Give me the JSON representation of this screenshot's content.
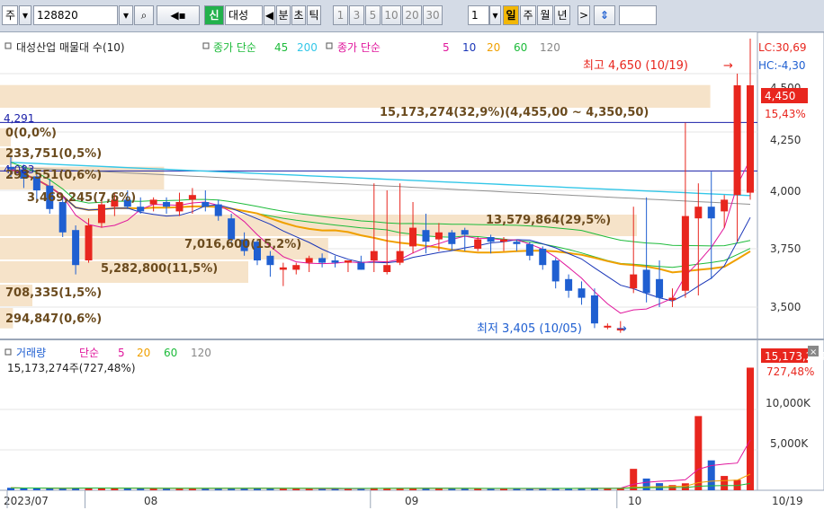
{
  "toolbar": {
    "market": "주",
    "code": "128820",
    "search_icon": "search-icon",
    "sound_icon": "speaker-icon",
    "new_badge": "신",
    "stock_name": "대성",
    "prev_arrow": "◀",
    "units": [
      "분",
      "초",
      "틱"
    ],
    "periods": [
      "1",
      "3",
      "5",
      "10",
      "20",
      "30"
    ],
    "count": "1",
    "day": "일",
    "week": "주",
    "month": "월",
    "year": "년",
    "next_arrow": ">",
    "updown_icon": "updown-arrow-icon"
  },
  "price_panel": {
    "legend": {
      "volume_profile": "대성산업 매물대 수(10)",
      "ma_label_1": "종가 단순",
      "ma_values_1": [
        "45",
        "200"
      ],
      "ma_label_2": "종가 단순",
      "ma_values_2": [
        "5",
        "10",
        "20",
        "60",
        "120"
      ]
    },
    "lc": "LC:30,69",
    "hc": "HC:-4,30",
    "high_note": "최고 4,650 (10/19)",
    "low_note": "최저 3,405 (10/05)",
    "current_price": "4,450",
    "current_pct": "15,43%",
    "line_4291": "4,291",
    "line_4083": "4,083",
    "profile_labels": [
      "15,173,274(32,9%)(4,455,00 ~ 4,350,50)",
      "0(0,0%)",
      "233,751(0,5%)",
      "293,551(0,6%)",
      "3,469,245(7,6%)",
      "13,579,864(29,5%)",
      "7,016,600(15,2%)",
      "5,282,800(11,5%)",
      "708,335(1,5%)",
      "294,847(0,6%)"
    ],
    "y_ticks": [
      "4,500",
      "4,250",
      "4,000",
      "3,750",
      "3,500"
    ]
  },
  "volume_panel": {
    "legend_title": "거래량",
    "legend_ma_label": "단순",
    "legend_ma_values": [
      "5",
      "20",
      "60",
      "120"
    ],
    "info": "15,173,274주(727,48%)",
    "current_volume": "15,173,274",
    "current_pct": "727,48%",
    "y_ticks": [
      "10,000K",
      "5,000K"
    ]
  },
  "x_axis": {
    "labels": [
      "2023/07",
      "08",
      "09",
      "10"
    ],
    "end_date": "10/19"
  },
  "colors": {
    "up": "#e8261e",
    "down": "#1f5fd1",
    "ma5": "#e0169c",
    "ma10": "#1a36b8",
    "ma20": "#f0a000",
    "ma60": "#1dbb3a",
    "ma120": "#909090",
    "ma45": "#1dbb3a",
    "ma200": "#33c7e8",
    "profile": "#f6e3c9",
    "profile_text": "#6b4b1e",
    "hline": "#1a1fa8"
  },
  "chart_data": {
    "type": "candlestick",
    "x": [
      "2023-07-24",
      "2023-07-25",
      "2023-07-26",
      "2023-07-27",
      "2023-07-28",
      "2023-07-31",
      "2023-08-01",
      "2023-08-02",
      "2023-08-03",
      "2023-08-04",
      "2023-08-07",
      "2023-08-08",
      "2023-08-09",
      "2023-08-10",
      "2023-08-11",
      "2023-08-14",
      "2023-08-16",
      "2023-08-17",
      "2023-08-18",
      "2023-08-21",
      "2023-08-22",
      "2023-08-23",
      "2023-08-24",
      "2023-08-25",
      "2023-08-28",
      "2023-08-29",
      "2023-08-30",
      "2023-08-31",
      "2023-09-01",
      "2023-09-04",
      "2023-09-05",
      "2023-09-06",
      "2023-09-07",
      "2023-09-08",
      "2023-09-11",
      "2023-09-12",
      "2023-09-13",
      "2023-09-14",
      "2023-09-15",
      "2023-09-18",
      "2023-09-19",
      "2023-09-20",
      "2023-09-21",
      "2023-09-22",
      "2023-09-25",
      "2023-09-26",
      "2023-09-27",
      "2023-10-04",
      "2023-10-05",
      "2023-10-06",
      "2023-10-10",
      "2023-10-11",
      "2023-10-12",
      "2023-10-13",
      "2023-10-16",
      "2023-10-17",
      "2023-10-18",
      "2023-10-19"
    ],
    "open": [
      4100,
      4090,
      4060,
      4020,
      3950,
      3830,
      3700,
      3860,
      3930,
      3960,
      3930,
      3940,
      3950,
      3910,
      3960,
      3950,
      3940,
      3880,
      3790,
      3780,
      3720,
      3660,
      3660,
      3690,
      3710,
      3700,
      3690,
      3690,
      3700,
      3650,
      3690,
      3760,
      3830,
      3790,
      3820,
      3830,
      3750,
      3800,
      3780,
      3780,
      3770,
      3750,
      3700,
      3620,
      3580,
      3550,
      3420,
      3400,
      3580,
      3660,
      3620,
      3530,
      3570,
      3880,
      3930,
      3910,
      3980,
      3990
    ],
    "high": [
      4150,
      4110,
      4080,
      4050,
      3970,
      3850,
      3880,
      3970,
      3990,
      4000,
      3970,
      3970,
      3970,
      3990,
      4010,
      4000,
      3960,
      3900,
      3820,
      3790,
      3740,
      3690,
      3690,
      3720,
      3730,
      3720,
      3700,
      3720,
      4030,
      4000,
      4030,
      3950,
      3900,
      3860,
      3830,
      3840,
      3800,
      3810,
      3800,
      3790,
      3780,
      3760,
      3710,
      3640,
      3610,
      3580,
      3430,
      3440,
      3930,
      3970,
      3700,
      3580,
      4290,
      4030,
      4080,
      3980,
      4500,
      4650
    ],
    "low": [
      4050,
      4010,
      3960,
      3900,
      3800,
      3640,
      3690,
      3840,
      3890,
      3920,
      3900,
      3910,
      3900,
      3890,
      3900,
      3910,
      3870,
      3770,
      3720,
      3680,
      3630,
      3590,
      3640,
      3650,
      3670,
      3670,
      3650,
      3660,
      3650,
      3640,
      3680,
      3730,
      3730,
      3740,
      3740,
      3740,
      3740,
      3730,
      3740,
      3740,
      3700,
      3660,
      3580,
      3540,
      3510,
      3410,
      3405,
      3390,
      3560,
      3520,
      3500,
      3500,
      3540,
      3550,
      3620,
      3840,
      3780,
      3960
    ],
    "close": [
      4090,
      4050,
      4000,
      3920,
      3820,
      3680,
      3850,
      3940,
      3960,
      3930,
      3910,
      3960,
      3930,
      3950,
      3980,
      3930,
      3890,
      3790,
      3740,
      3700,
      3680,
      3670,
      3680,
      3710,
      3690,
      3690,
      3700,
      3660,
      3740,
      3680,
      3740,
      3840,
      3780,
      3820,
      3770,
      3810,
      3790,
      3780,
      3790,
      3770,
      3720,
      3680,
      3610,
      3570,
      3540,
      3430,
      3420,
      3410,
      3640,
      3560,
      3540,
      3540,
      3890,
      3930,
      3880,
      3960,
      4450,
      4450
    ],
    "volume_k": [
      310,
      250,
      260,
      240,
      230,
      330,
      300,
      280,
      240,
      230,
      220,
      230,
      240,
      210,
      230,
      220,
      230,
      250,
      240,
      260,
      220,
      200,
      190,
      210,
      200,
      200,
      190,
      200,
      300,
      260,
      260,
      280,
      240,
      220,
      210,
      230,
      220,
      200,
      210,
      200,
      190,
      210,
      260,
      250,
      250,
      260,
      280,
      290,
      2650,
      1450,
      880,
      640,
      860,
      9180,
      3700,
      1770,
      1300,
      15173
    ]
  }
}
